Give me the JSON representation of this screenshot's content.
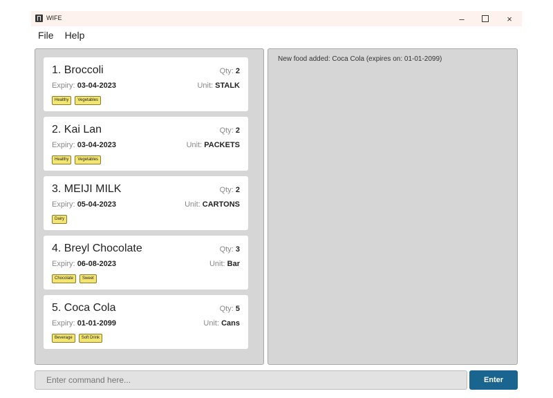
{
  "window": {
    "title": "WIFE",
    "controls": {
      "minimize": "–",
      "maximize": "□",
      "close": "×"
    }
  },
  "menu": {
    "items": [
      "File",
      "Help"
    ]
  },
  "food_list": [
    {
      "index": "1.",
      "name": "Broccoli",
      "qty_label": "Qty:",
      "qty": "2",
      "expiry_label": "Expiry:",
      "expiry": "03-04-2023",
      "unit_label": "Unit:",
      "unit": "STALK",
      "tags": [
        "Healthy",
        "Vegetables"
      ]
    },
    {
      "index": "2.",
      "name": "Kai Lan",
      "qty_label": "Qty:",
      "qty": "2",
      "expiry_label": "Expiry:",
      "expiry": "03-04-2023",
      "unit_label": "Unit:",
      "unit": "PACKETS",
      "tags": [
        "Healthy",
        "Vegetables"
      ]
    },
    {
      "index": "3.",
      "name": "MEIJI MILK",
      "qty_label": "Qty:",
      "qty": "2",
      "expiry_label": "Expiry:",
      "expiry": "05-04-2023",
      "unit_label": "Unit:",
      "unit": "CARTONS",
      "tags": [
        "Dairy"
      ]
    },
    {
      "index": "4.",
      "name": "Breyl Chocolate",
      "qty_label": "Qty:",
      "qty": "3",
      "expiry_label": "Expiry:",
      "expiry": "06-08-2023",
      "unit_label": "Unit:",
      "unit": "Bar",
      "tags": [
        "Chocolate",
        "Sweet"
      ]
    },
    {
      "index": "5.",
      "name": "Coca Cola",
      "qty_label": "Qty:",
      "qty": "5",
      "expiry_label": "Expiry:",
      "expiry": "01-01-2099",
      "unit_label": "Unit:",
      "unit": "Cans",
      "tags": [
        "Beverage",
        "Soft Drink"
      ]
    }
  ],
  "result_display": "New food added: Coca Cola (expires on: 01-01-2099)",
  "command_box": {
    "placeholder": "Enter command here...",
    "value": ""
  },
  "enter_button": "Enter",
  "colors": {
    "accent": "#19658f",
    "tag_bg": "#f3e571",
    "pane_bg": "#d6d6d6",
    "titlebar_bg": "#fdf2ee"
  }
}
